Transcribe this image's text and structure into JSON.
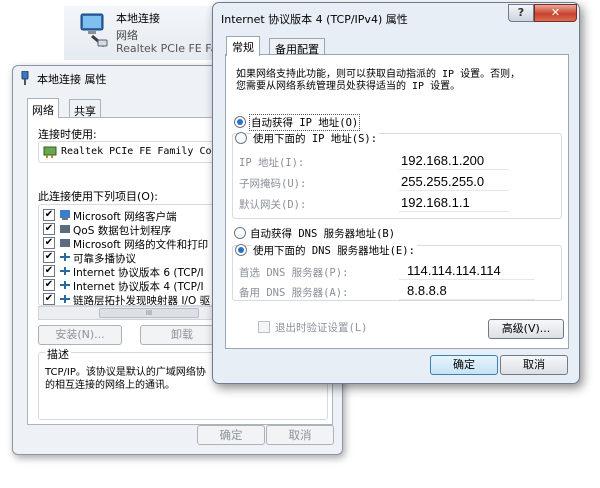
{
  "background_item": {
    "name": "本地连接",
    "type": "网络",
    "device": "Realtek PCIe FE Fa"
  },
  "back_window": {
    "title": "本地连接 属性",
    "tabs": [
      "网络",
      "共享"
    ],
    "connect_using_label": "连接时使用:",
    "adapter": "Realtek PCIe FE Family Contr",
    "items_label": "此连接使用下列项目(O):",
    "items": [
      {
        "label": "Microsoft 网络客户端",
        "checked": true
      },
      {
        "label": "QoS 数据包计划程序",
        "checked": true
      },
      {
        "label": "Microsoft 网络的文件和打印",
        "checked": true
      },
      {
        "label": "可靠多播协议",
        "checked": true
      },
      {
        "label": "Internet 协议版本 6 (TCP/I",
        "checked": true
      },
      {
        "label": "Internet 协议版本 4 (TCP/I",
        "checked": true
      },
      {
        "label": "链路层拓扑发现映射器 I/O 驱",
        "checked": true
      }
    ],
    "scroll_mark": "III",
    "install_label": "安装(N)...",
    "uninstall_label": "卸载",
    "description_label": "描述",
    "description_text": "TCP/IP。该协议是默认的广域网络协",
    "description_text2": "的相互连接的网络上的通讯。",
    "ok_label": "确定",
    "cancel_label": "取消"
  },
  "front_window": {
    "title": "Internet 协议版本 4 (TCP/IPv4) 属性",
    "help_label": "?",
    "close_label": "✕",
    "tabs": [
      "常规",
      "备用配置"
    ],
    "intro_line1": "如果网络支持此功能，则可以获取自动指派的 IP 设置。否则，",
    "intro_line2": "您需要从网络系统管理员处获得适当的 IP 设置。",
    "auto_ip_label": "自动获得 IP 地址(O)",
    "manual_ip_label": "使用下面的 IP 地址(S):",
    "ip_label": "IP 地址(I):",
    "ip_value": "192.168.1.200",
    "mask_label": "子网掩码(U):",
    "mask_value": "255.255.255.0",
    "gateway_label": "默认网关(D):",
    "gateway_value": "192.168.1.1",
    "auto_dns_label": "自动获得 DNS 服务器地址(B)",
    "manual_dns_label": "使用下面的 DNS 服务器地址(E):",
    "dns1_label": "首选 DNS 服务器(P):",
    "dns1_value": "114.114.114.114",
    "dns2_label": "备用 DNS 服务器(A):",
    "dns2_value": "8.8.8.8",
    "validate_label": "退出时验证设置(L)",
    "advanced_label": "高级(V)...",
    "ok_label": "确定",
    "cancel_label": "取消"
  }
}
